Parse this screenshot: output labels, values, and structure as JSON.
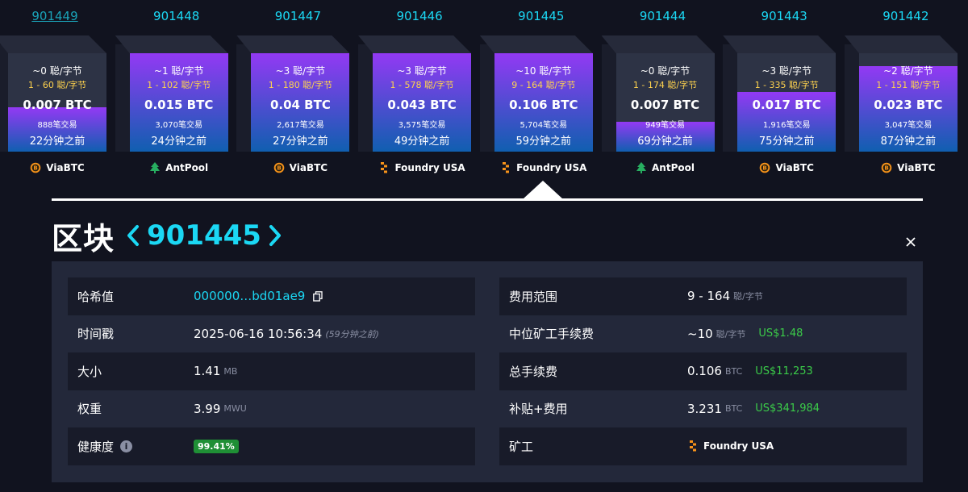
{
  "blocks": [
    {
      "height": "901449",
      "fee_median": "~0 聪/字节",
      "fee_range": "1 - 60 聪/字节",
      "total_btc": "0.007 BTC",
      "tx_count": "888笔交易",
      "time_ago": "22分钟之前",
      "pool": "ViaBTC",
      "pool_icon": "viabtc-icon",
      "fill_fraction": 0.45
    },
    {
      "height": "901448",
      "fee_median": "~1 聪/字节",
      "fee_range": "1 - 102 聪/字节",
      "total_btc": "0.015 BTC",
      "tx_count": "3,070笔交易",
      "time_ago": "24分钟之前",
      "pool": "AntPool",
      "pool_icon": "antpool-icon",
      "fill_fraction": 1.0
    },
    {
      "height": "901447",
      "fee_median": "~3 聪/字节",
      "fee_range": "1 - 180 聪/字节",
      "total_btc": "0.04 BTC",
      "tx_count": "2,617笔交易",
      "time_ago": "27分钟之前",
      "pool": "ViaBTC",
      "pool_icon": "viabtc-icon",
      "fill_fraction": 1.0
    },
    {
      "height": "901446",
      "fee_median": "~3 聪/字节",
      "fee_range": "1 - 578 聪/字节",
      "total_btc": "0.043 BTC",
      "tx_count": "3,575笔交易",
      "time_ago": "49分钟之前",
      "pool": "Foundry USA",
      "pool_icon": "foundry-icon",
      "fill_fraction": 1.0
    },
    {
      "height": "901445",
      "fee_median": "~10 聪/字节",
      "fee_range": "9 - 164 聪/字节",
      "total_btc": "0.106 BTC",
      "tx_count": "5,704笔交易",
      "time_ago": "59分钟之前",
      "pool": "Foundry USA",
      "pool_icon": "foundry-icon",
      "fill_fraction": 1.0
    },
    {
      "height": "901444",
      "fee_median": "~0 聪/字节",
      "fee_range": "1 - 174 聪/字节",
      "total_btc": "0.007 BTC",
      "tx_count": "949笔交易",
      "time_ago": "69分钟之前",
      "pool": "AntPool",
      "pool_icon": "antpool-icon",
      "fill_fraction": 0.3
    },
    {
      "height": "901443",
      "fee_median": "~3 聪/字节",
      "fee_range": "1 - 335 聪/字节",
      "total_btc": "0.017 BTC",
      "tx_count": "1,916笔交易",
      "time_ago": "75分钟之前",
      "pool": "ViaBTC",
      "pool_icon": "viabtc-icon",
      "fill_fraction": 0.61
    },
    {
      "height": "901442",
      "fee_median": "~2 聪/字节",
      "fee_range": "1 - 151 聪/字节",
      "total_btc": "0.023 BTC",
      "tx_count": "3,047笔交易",
      "time_ago": "87分钟之前",
      "pool": "ViaBTC",
      "pool_icon": "viabtc-icon",
      "fill_fraction": 0.87
    }
  ],
  "title": {
    "label": "区块",
    "height": "901445",
    "prev_icon": "chevron-left-icon",
    "next_icon": "chevron-right-icon",
    "close_icon": "close-icon"
  },
  "details": {
    "left": [
      {
        "label": "哈希值",
        "value": "000000…bd01ae9",
        "icon": "copy-icon"
      },
      {
        "label": "时间戳",
        "value": "2025-06-16 10:56:34",
        "note": "(59分钟之前)"
      },
      {
        "label": "大小",
        "value": "1.41",
        "unit": "MB"
      },
      {
        "label": "权重",
        "value": "3.99",
        "unit": "MWU"
      },
      {
        "label": "健康度",
        "value": "99.41%",
        "icon": "info-icon"
      }
    ],
    "right": [
      {
        "label": "费用范围",
        "value": "9 - 164",
        "unit": "聪/字节"
      },
      {
        "label": "中位矿工手续费",
        "value": "~10",
        "unit": "聪/字节",
        "usd": "US$1.48"
      },
      {
        "label": "总手续费",
        "value": "0.106",
        "unit": "BTC",
        "usd": "US$11,253"
      },
      {
        "label": "补贴+费用",
        "value": "3.231",
        "unit": "BTC",
        "usd": "US$341,984"
      },
      {
        "label": "矿工",
        "value": "Foundry USA",
        "icon": "foundry-icon"
      }
    ]
  },
  "colors": {
    "background": "#11131f",
    "accent_cyan": "#1bd8f4",
    "fee_yellow": "#ffd34e",
    "usd_green": "#3bcc49",
    "block_gradient_top": "#9339f4",
    "block_gradient_bottom": "#105fb0",
    "health_badge": "#1f8f35"
  }
}
